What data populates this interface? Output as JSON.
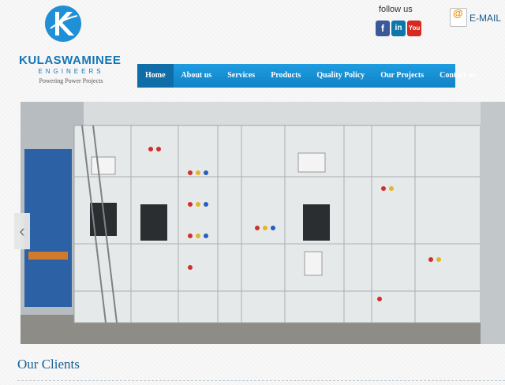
{
  "logo": {
    "name": "KULASWAMINEE",
    "sub": "ENGINEERS",
    "tagline": "Powering Power Projects"
  },
  "social": {
    "follow_label": "follow us",
    "facebook_glyph": "f",
    "linkedin_glyph": "in",
    "youtube_glyph": "You"
  },
  "email": {
    "icon_glyph": "@",
    "label": "E-MAIL"
  },
  "nav": {
    "items": [
      {
        "label": "Home",
        "active": true
      },
      {
        "label": "About us"
      },
      {
        "label": "Services"
      },
      {
        "label": "Products"
      },
      {
        "label": "Quality Policy"
      },
      {
        "label": "Our Projects"
      },
      {
        "label": "Contact us"
      }
    ]
  },
  "slider": {
    "prev_glyph": "‹",
    "next_glyph": "›"
  },
  "clients": {
    "title": "Our Clients"
  },
  "colors": {
    "brand_blue": "#1476b8",
    "nav_blue": "#1a8fd4",
    "nav_active": "#0f6ea8"
  }
}
